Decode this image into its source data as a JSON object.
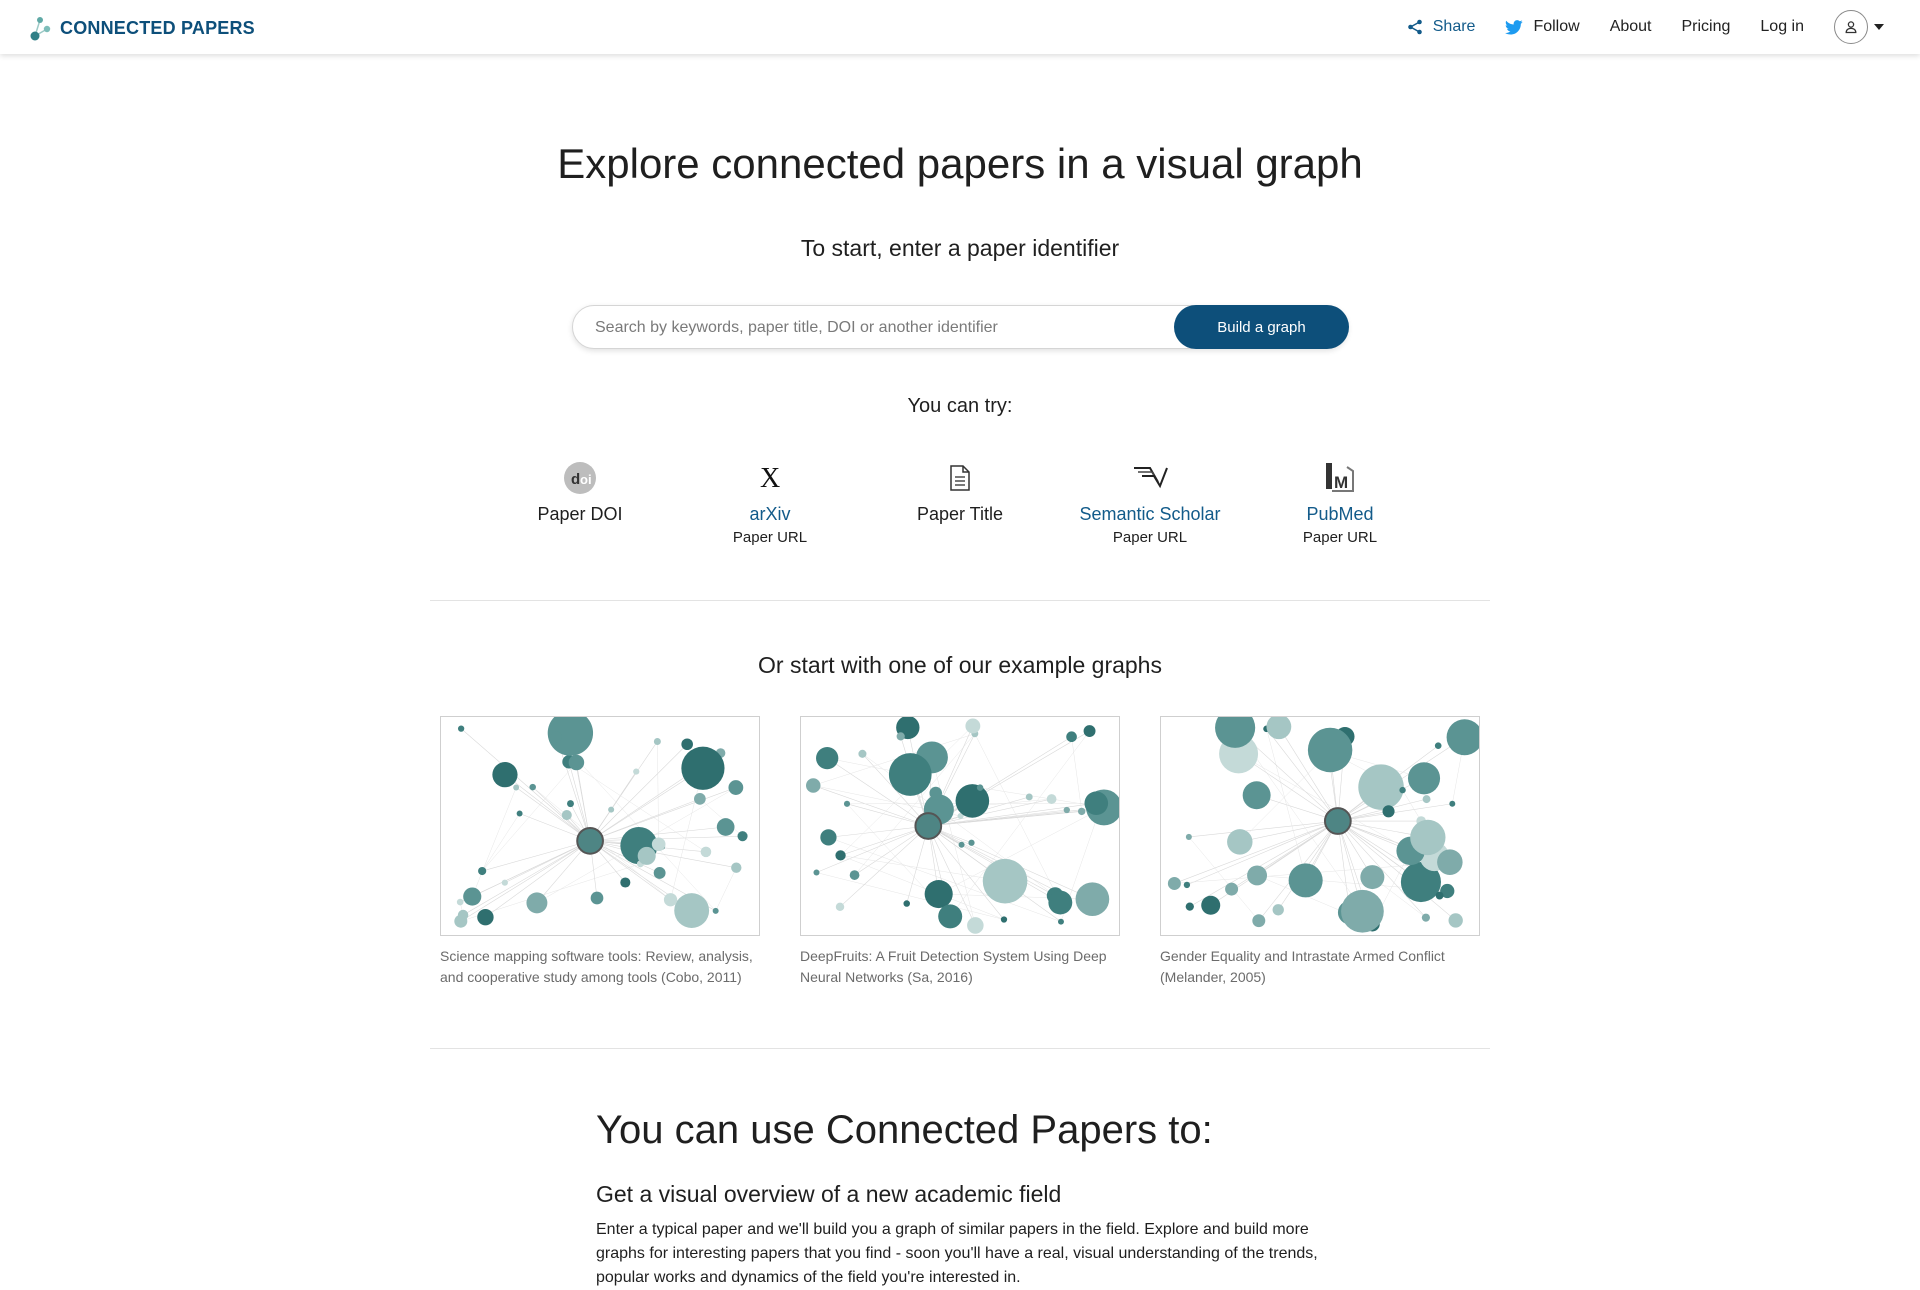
{
  "brand": {
    "name": "CONNECTED PAPERS",
    "color": "#0d4f7a",
    "accent": "#4a9a98"
  },
  "nav": {
    "share": {
      "label": "Share",
      "icon": "share-icon"
    },
    "follow": {
      "label": "Follow",
      "icon": "twitter-icon"
    },
    "about": "About",
    "pricing": "Pricing",
    "login": "Log in",
    "account_icon": "user-icon"
  },
  "hero": {
    "title": "Explore connected papers in a visual graph",
    "subtitle": "To start, enter a paper identifier",
    "search_placeholder": "Search by keywords, paper title, DOI or another identifier",
    "search_value": "",
    "build_button": "Build a graph"
  },
  "try": {
    "label": "You can try:",
    "items": [
      {
        "name": "Paper DOI",
        "sub": "",
        "icon": "doi-icon",
        "link": false
      },
      {
        "name": "arXiv",
        "sub": "Paper URL",
        "icon": "arxiv-icon",
        "link": true
      },
      {
        "name": "Paper Title",
        "sub": "",
        "icon": "document-icon",
        "link": false
      },
      {
        "name": "Semantic Scholar",
        "sub": "Paper URL",
        "icon": "semantic-scholar-icon",
        "link": true
      },
      {
        "name": "PubMed",
        "sub": "Paper URL",
        "icon": "pubmed-icon",
        "link": true
      }
    ]
  },
  "examples": {
    "title": "Or start with one of our example graphs",
    "items": [
      {
        "caption": "Science mapping software tools: Review, analysis, and cooperative study among tools (Cobo, 2011)"
      },
      {
        "caption": "DeepFruits: A Fruit Detection System Using Deep Neural Networks (Sa, 2016)"
      },
      {
        "caption": "Gender Equality and Intrastate Armed Conflict (Melander, 2005)"
      }
    ]
  },
  "uses": {
    "title": "You can use Connected Papers to:",
    "first_heading": "Get a visual overview of a new academic field",
    "first_text": "Enter a typical paper and we'll build you a graph of similar papers in the field. Explore and build more graphs for interesting papers that you find - soon you'll have a real, visual understanding of the trends, popular works and dynamics of the field you're interested in."
  }
}
